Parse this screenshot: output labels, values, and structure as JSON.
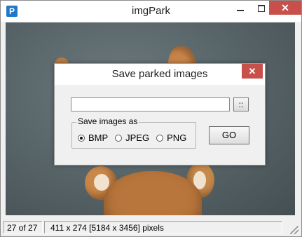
{
  "window": {
    "title": "imgPark",
    "app_icon_letter": "P",
    "close_glyph": "✕"
  },
  "status": {
    "count": "27 of 27",
    "size": "411 x 274 [5184 x 3456] pixels"
  },
  "dialog": {
    "title": "Save parked images",
    "close_glyph": "✕",
    "path_value": "",
    "browse_label": "::",
    "group_label": "Save images as",
    "formats": [
      {
        "label": "BMP",
        "checked": true
      },
      {
        "label": "JPEG",
        "checked": false
      },
      {
        "label": "PNG",
        "checked": false
      }
    ],
    "go_label": "GO"
  },
  "colors": {
    "close_red": "#c7504b",
    "app_icon_blue": "#1f78c8"
  }
}
